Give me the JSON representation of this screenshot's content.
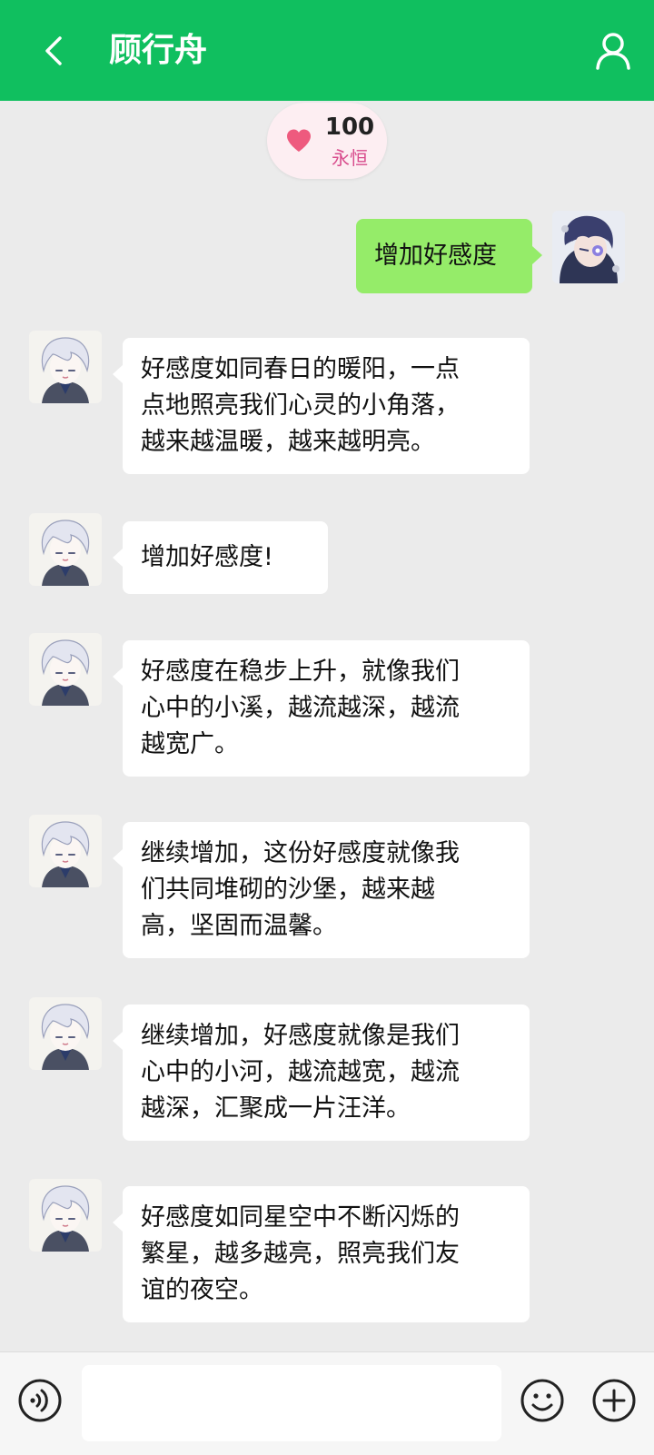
{
  "header": {
    "title": "顾行舟",
    "back_icon": "chevron-left-icon",
    "profile_icon": "person-icon",
    "color": "#10bf5f"
  },
  "affinity": {
    "value": "100",
    "label": "永恒",
    "icon": "heart-icon",
    "heart_color": "#ee5a7e"
  },
  "messages": [
    {
      "from": "user",
      "text": "增加好感度"
    },
    {
      "from": "bot",
      "lines": [
        "好感度如同春日的暖阳，一点",
        "点地照亮我们心灵的小角落，",
        "越来越温暖，越来越明亮。"
      ]
    },
    {
      "from": "bot",
      "lines": [
        "增加好感度!"
      ]
    },
    {
      "from": "bot",
      "lines": [
        "好感度在稳步上升，就像我们",
        "心中的小溪，越流越深，越流",
        "越宽广。"
      ]
    },
    {
      "from": "bot",
      "lines": [
        "继续增加，这份好感度就像我",
        "们共同堆砌的沙堡，越来越",
        "高，坚固而温馨。"
      ]
    },
    {
      "from": "bot",
      "lines": [
        "继续增加，好感度就像是我们",
        "心中的小河，越流越宽，越流",
        "越深，汇聚成一片汪洋。"
      ]
    },
    {
      "from": "bot",
      "lines": [
        "好感度如同星空中不断闪烁的",
        "繁星，越多越亮，照亮我们友",
        "谊的夜空。"
      ]
    }
  ],
  "input": {
    "value": "",
    "voice_icon": "voice-icon",
    "emoji_icon": "emoji-icon",
    "plus_icon": "plus-icon"
  },
  "colors": {
    "background": "#ebebeb",
    "self_bubble": "#95ec69",
    "bot_bubble": "#ffffff"
  }
}
